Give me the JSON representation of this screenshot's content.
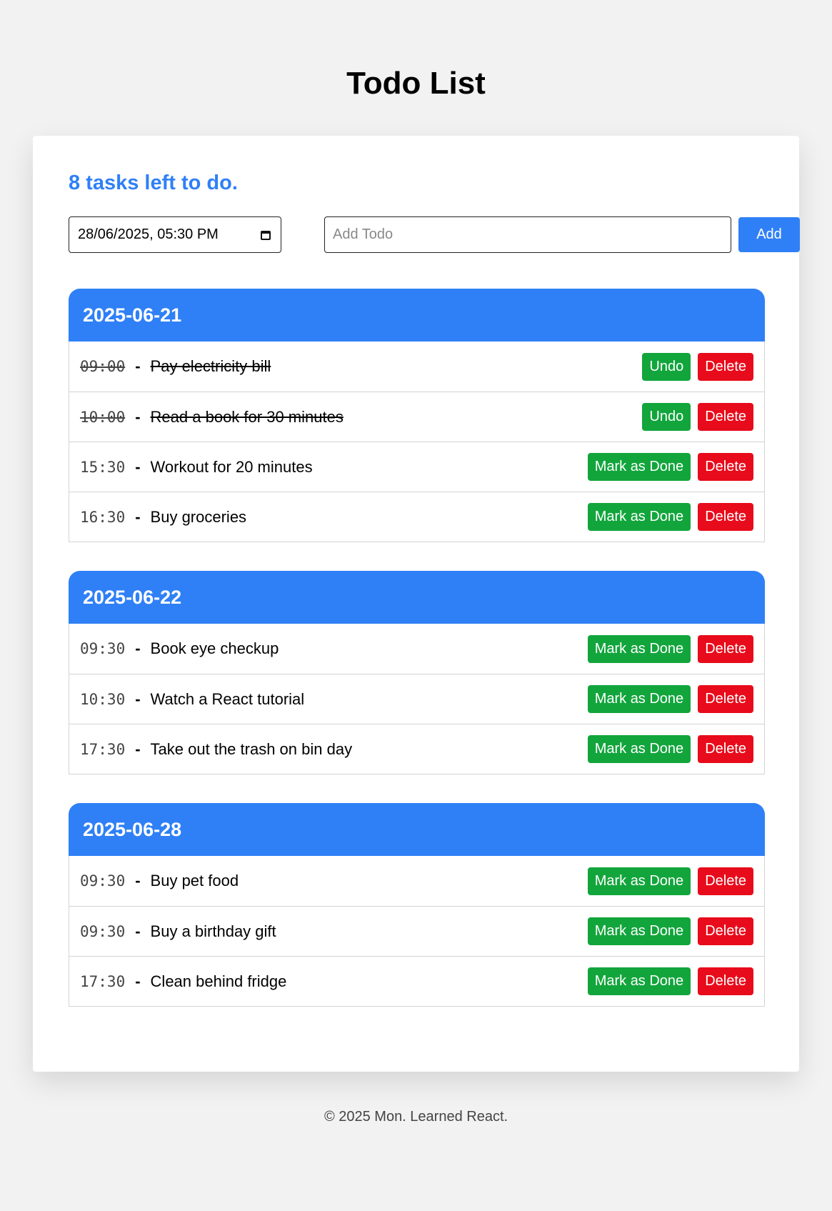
{
  "page": {
    "title": "Todo List"
  },
  "summary": {
    "tasks_left": "8 tasks left to do."
  },
  "form": {
    "datetime_value": "28/06/2025, 05:30 PM",
    "todo_placeholder": "Add Todo",
    "add_label": "Add"
  },
  "groups": [
    {
      "date": "2025-06-21",
      "tasks": [
        {
          "time": "09:00",
          "text": "Pay electricity bill",
          "done": true,
          "action_label": "Undo",
          "delete_label": "Delete"
        },
        {
          "time": "10:00",
          "text": "Read a book for 30 minutes",
          "done": true,
          "action_label": "Undo",
          "delete_label": "Delete"
        },
        {
          "time": "15:30",
          "text": "Workout for 20 minutes",
          "done": false,
          "action_label": "Mark as Done",
          "delete_label": "Delete"
        },
        {
          "time": "16:30",
          "text": "Buy groceries",
          "done": false,
          "action_label": "Mark as Done",
          "delete_label": "Delete"
        }
      ]
    },
    {
      "date": "2025-06-22",
      "tasks": [
        {
          "time": "09:30",
          "text": "Book eye checkup",
          "done": false,
          "action_label": "Mark as Done",
          "delete_label": "Delete"
        },
        {
          "time": "10:30",
          "text": "Watch a React tutorial",
          "done": false,
          "action_label": "Mark as Done",
          "delete_label": "Delete"
        },
        {
          "time": "17:30",
          "text": "Take out the trash on bin day",
          "done": false,
          "action_label": "Mark as Done",
          "delete_label": "Delete"
        }
      ]
    },
    {
      "date": "2025-06-28",
      "tasks": [
        {
          "time": "09:30",
          "text": "Buy pet food",
          "done": false,
          "action_label": "Mark as Done",
          "delete_label": "Delete"
        },
        {
          "time": "09:30",
          "text": "Buy a birthday gift",
          "done": false,
          "action_label": "Mark as Done",
          "delete_label": "Delete"
        },
        {
          "time": "17:30",
          "text": "Clean behind fridge",
          "done": false,
          "action_label": "Mark as Done",
          "delete_label": "Delete"
        }
      ]
    }
  ],
  "footer": {
    "text": "© 2025 Mon. Learned React."
  },
  "colors": {
    "accent": "#2f80f6",
    "success": "#12a53c",
    "danger": "#e80b1b",
    "background": "#f2f2f2"
  }
}
